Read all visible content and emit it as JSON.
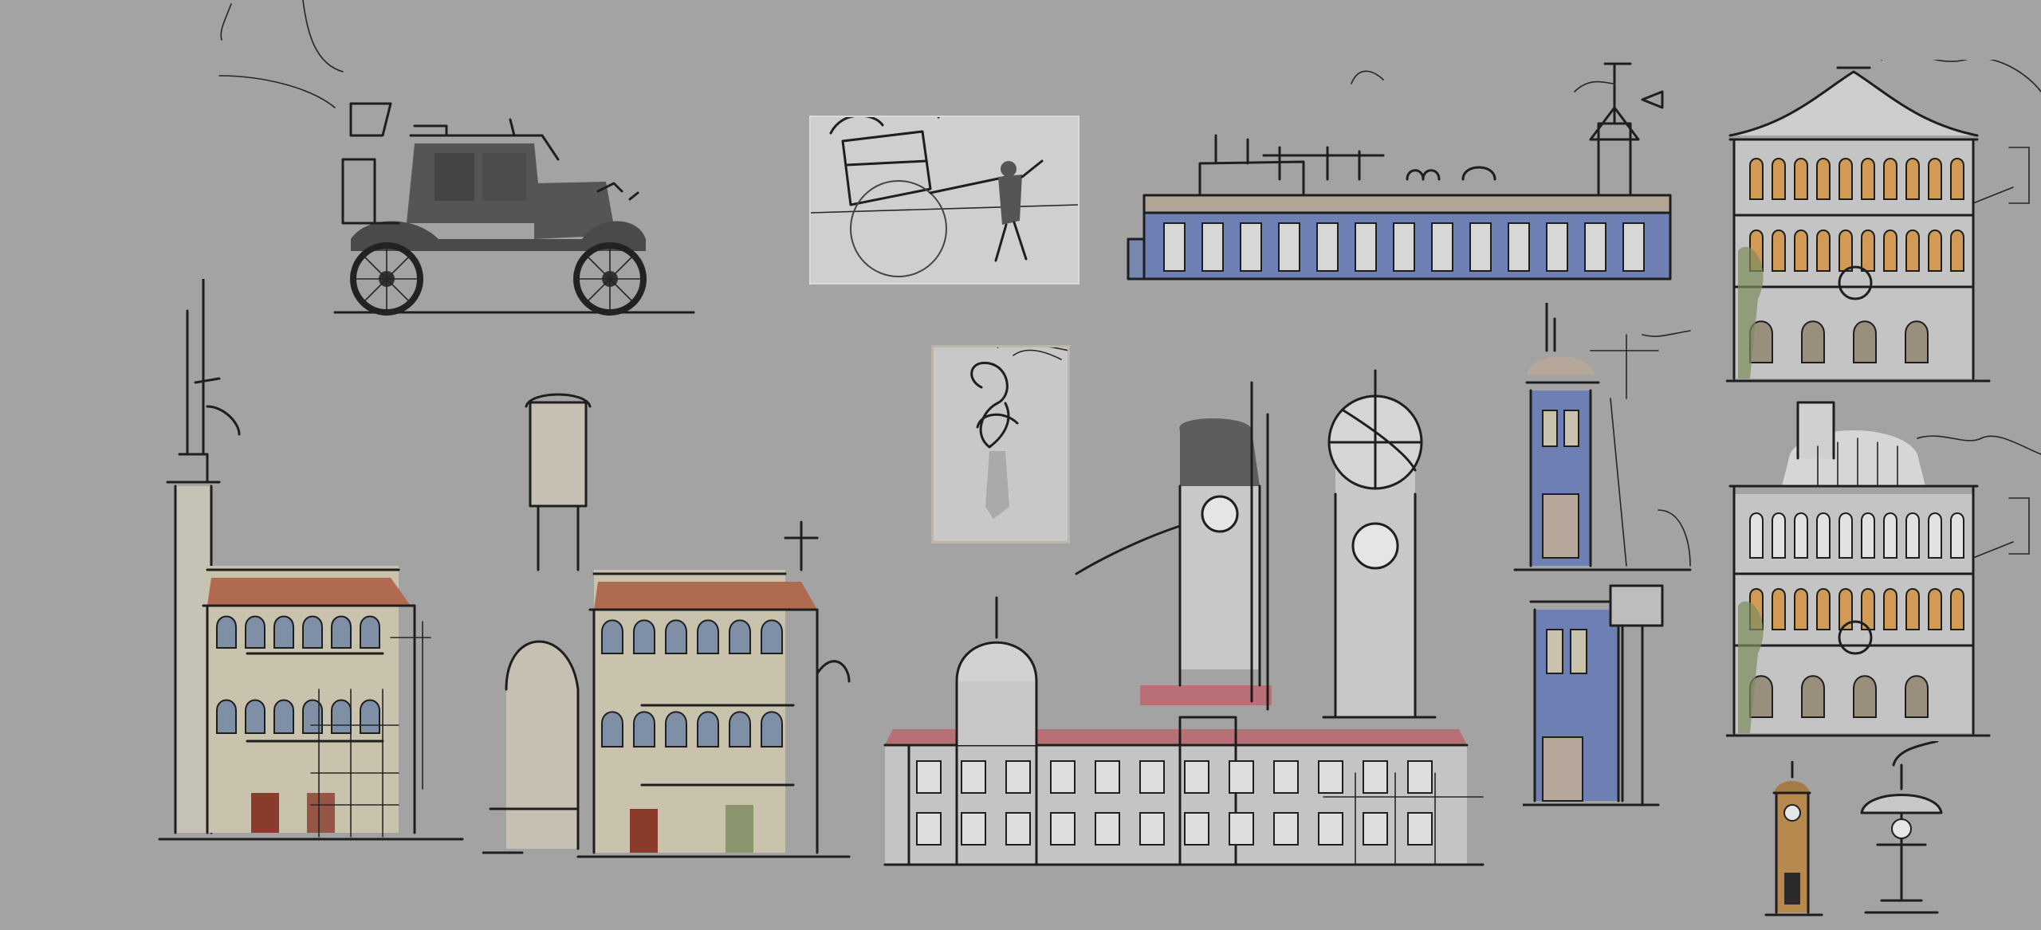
{
  "canvas": {
    "background": "#a3a3a3",
    "ink": "#1e1e1e",
    "palette": {
      "roof_terracotta": "#b06a50",
      "wall_cream": "#c9c3ad",
      "wall_blue": "#6d7fb3",
      "wall_grey": "#c4c4c4",
      "shutter_orange": "#d19a55",
      "door_red": "#8a3b2b",
      "foliage_green": "#7c8b5f",
      "clock_face": "#e5e5e5",
      "kiosk_gold": "#b8894f"
    }
  },
  "items": [
    {
      "kind": "vehicle",
      "name": "vintage-car-sketch"
    },
    {
      "kind": "reference-photo",
      "name": "rickshaw-reference"
    },
    {
      "kind": "reference-photo",
      "name": "figure-reference"
    },
    {
      "kind": "building",
      "name": "long-blue-warehouse"
    },
    {
      "kind": "building",
      "name": "shophouse-with-chimney"
    },
    {
      "kind": "building",
      "name": "shophouse-with-water-tower"
    },
    {
      "kind": "building",
      "name": "domed-station-with-clock-towers"
    },
    {
      "kind": "building",
      "name": "blue-turret-tower-upper"
    },
    {
      "kind": "building",
      "name": "blue-turret-tower-lower"
    },
    {
      "kind": "building",
      "name": "ornate-facade-upper"
    },
    {
      "kind": "building",
      "name": "ornate-facade-lower"
    },
    {
      "kind": "prop",
      "name": "small-clock-kiosk"
    },
    {
      "kind": "prop",
      "name": "lamp-post-kiosk"
    }
  ]
}
